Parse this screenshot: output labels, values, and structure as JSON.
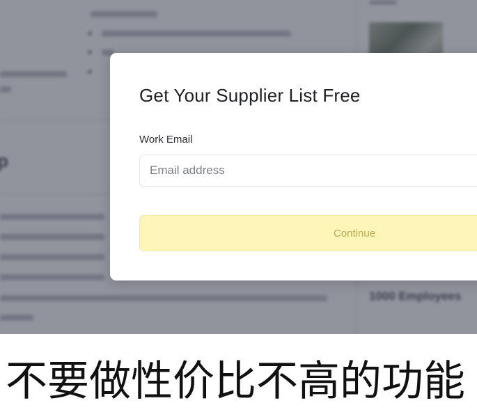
{
  "modal": {
    "title": "Get Your Supplier List Free",
    "email_label": "Work Email",
    "email_placeholder": "Email address",
    "email_value": "",
    "continue_label": "Continue",
    "continue_bg_color": "#fdf6b8",
    "continue_text_color": "#b7ab58"
  },
  "background": {
    "heading_fragment": "p",
    "side_stat": "1000 Employees"
  },
  "caption": {
    "text": "不要做性价比不高的功能"
  }
}
